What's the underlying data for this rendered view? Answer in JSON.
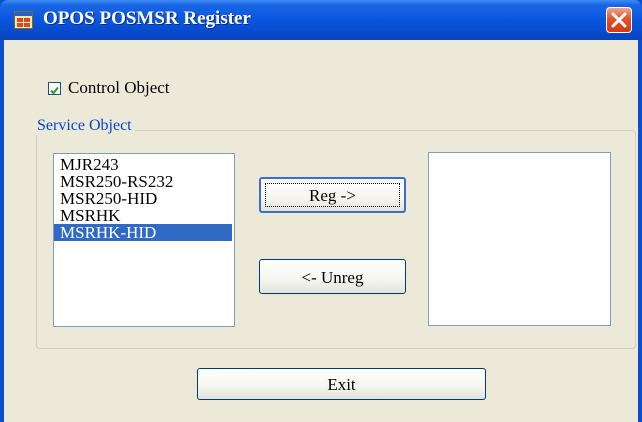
{
  "window": {
    "title": "OPOS POSMSR Register",
    "app_icon": "app-window-icon",
    "close_icon": "close-icon"
  },
  "control_object": {
    "label": "Control Object",
    "checked": true
  },
  "service_object": {
    "group_label": "Service Object",
    "available_list": [
      "MJR243",
      "MSR250-RS232",
      "MSR250-HID",
      "MSRHK",
      "MSRHK-HID"
    ],
    "selected_index": 4,
    "registered_list": []
  },
  "buttons": {
    "register_label": "Reg ->",
    "unregister_label": "<- Unreg",
    "exit_label": "Exit"
  },
  "colors": {
    "titlebar": "#0a55df",
    "selection": "#316ac5",
    "group_label": "#0046d5",
    "close_button": "#e0532a",
    "dialog_background": "#ece9d8"
  }
}
